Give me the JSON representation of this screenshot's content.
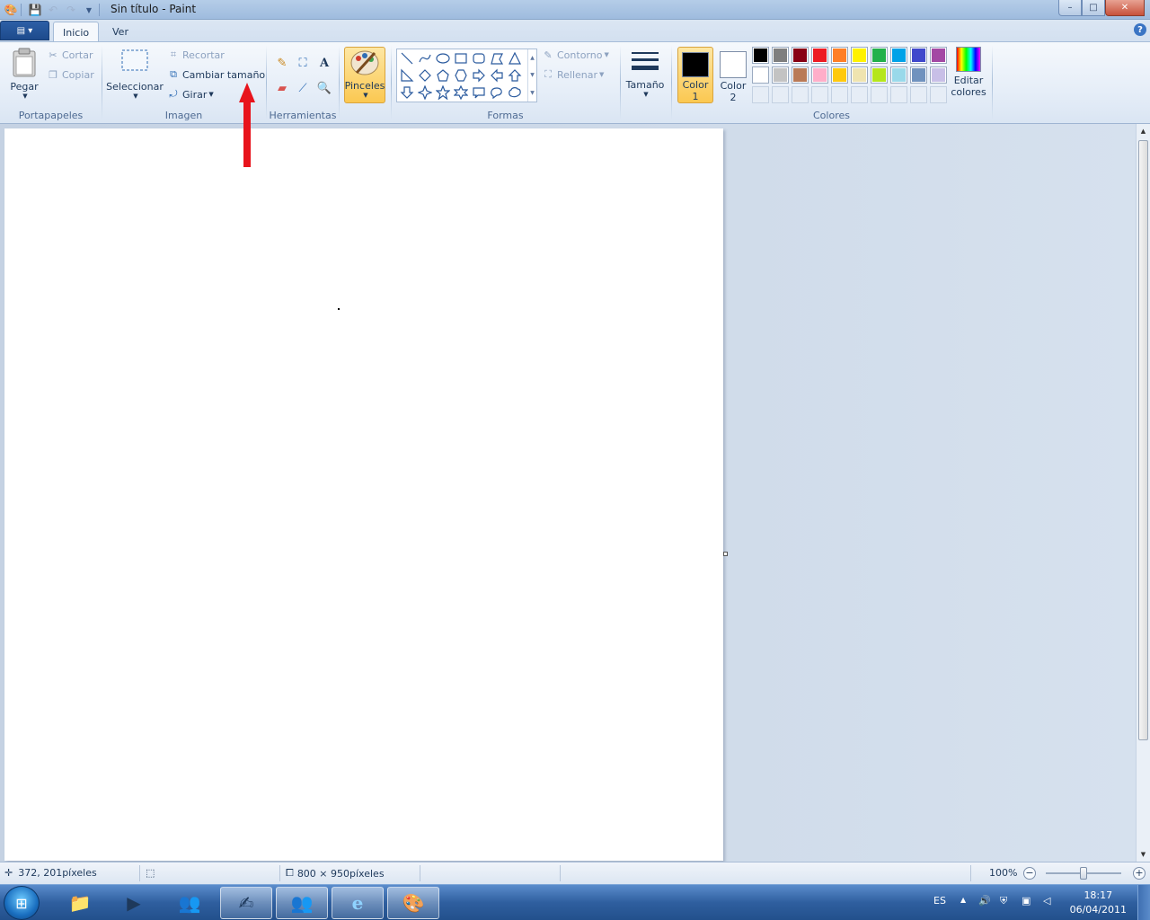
{
  "window": {
    "title": "Sin título - Paint",
    "minimize": "–",
    "maximize": "□",
    "close": "✕"
  },
  "tabs": [
    {
      "label": "Inicio"
    },
    {
      "label": "Ver"
    }
  ],
  "help": "?",
  "ribbon": {
    "clipboard": {
      "label": "Portapapeles",
      "paste": "Pegar",
      "cut": "Cortar",
      "copy": "Copiar"
    },
    "image": {
      "label": "Imagen",
      "select": "Seleccionar",
      "crop": "Recortar",
      "resize": "Cambiar tamaño",
      "rotate": "Girar"
    },
    "tools": {
      "label": "Herramientas"
    },
    "brushes": {
      "label": "Pinceles"
    },
    "shapes": {
      "label": "Formas",
      "outline": "Contorno",
      "fill": "Rellenar"
    },
    "size": {
      "label": "Tamaño"
    },
    "colors": {
      "label": "Colores",
      "color1_line1": "Color",
      "color1_line2": "1",
      "color2_line1": "Color",
      "color2_line2": "2",
      "color1": "#000000",
      "color2": "#ffffff",
      "edit_line1": "Editar",
      "edit_line2": "colores",
      "palette_row1": [
        "#000000",
        "#7f7f7f",
        "#880015",
        "#ed1c24",
        "#ff7f27",
        "#fff200",
        "#22b14c",
        "#00a2e8",
        "#3f48cc",
        "#a349a4"
      ],
      "palette_row2": [
        "#ffffff",
        "#c3c3c3",
        "#b97a57",
        "#ffaec9",
        "#ffc90e",
        "#efe4b0",
        "#b5e61d",
        "#99d9ea",
        "#7092be",
        "#c8bfe7"
      ]
    }
  },
  "annotation": {
    "arrow_color": "#e8141c"
  },
  "statusbar": {
    "cursor_pos": "372, 201píxeles",
    "canvas_size": "800 × 950píxeles",
    "zoom": "100%",
    "zoom_out": "−",
    "zoom_in": "+"
  },
  "taskbar": {
    "language": "ES",
    "time": "18:17",
    "date": "06/04/2011"
  }
}
